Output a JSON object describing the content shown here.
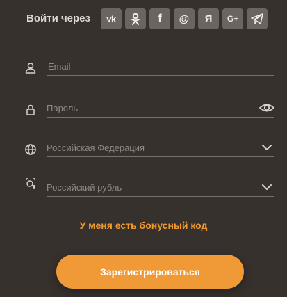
{
  "social": {
    "label": "Войти через",
    "buttons": [
      {
        "name": "vk",
        "text": "vk"
      },
      {
        "name": "odnoklassniki",
        "text": ""
      },
      {
        "name": "facebook",
        "text": "f"
      },
      {
        "name": "mailru",
        "text": "@"
      },
      {
        "name": "yandex",
        "text": "Я"
      },
      {
        "name": "google-plus",
        "text": "G+"
      },
      {
        "name": "telegram",
        "text": ""
      }
    ]
  },
  "form": {
    "email_placeholder": "Email",
    "password_placeholder": "Пароль",
    "country_value": "Российская Федерация",
    "currency_value": "Российский рубль",
    "bonus_link": "У меня есть бонусный код",
    "register_button": "Зарегистрироваться"
  },
  "colors": {
    "background": "#37312e",
    "accent": "#ef9a36"
  }
}
